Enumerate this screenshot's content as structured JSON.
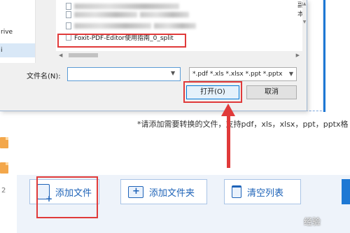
{
  "dialog": {
    "nav": {
      "item_1": "rive",
      "item_2": "i"
    },
    "files": [
      {
        "name": ""
      },
      {
        "name": ""
      },
      {
        "name": "Foxit-PDF-Editor使用指南_0_split"
      }
    ],
    "side_text": "副本",
    "filename_label": "文件名(N):",
    "filename_value": "",
    "filter_value": "*.pdf *.xls *.xlsx *.ppt *.pptx",
    "open_button": "打开(O)",
    "cancel_button": "取消"
  },
  "app": {
    "hint": "*请添加需要转换的文件，支持pdf，xls，xlsx，ppt，pptx格",
    "page_number": "2",
    "buttons": {
      "add_file": "添加文件",
      "add_folder": "添加文件夹",
      "clear_list": "清空列表"
    },
    "watermark": "经验"
  },
  "colors": {
    "accent": "#1e63b8",
    "annotation": "#e03a3a",
    "dialog_bg": "#f0f0f0"
  }
}
